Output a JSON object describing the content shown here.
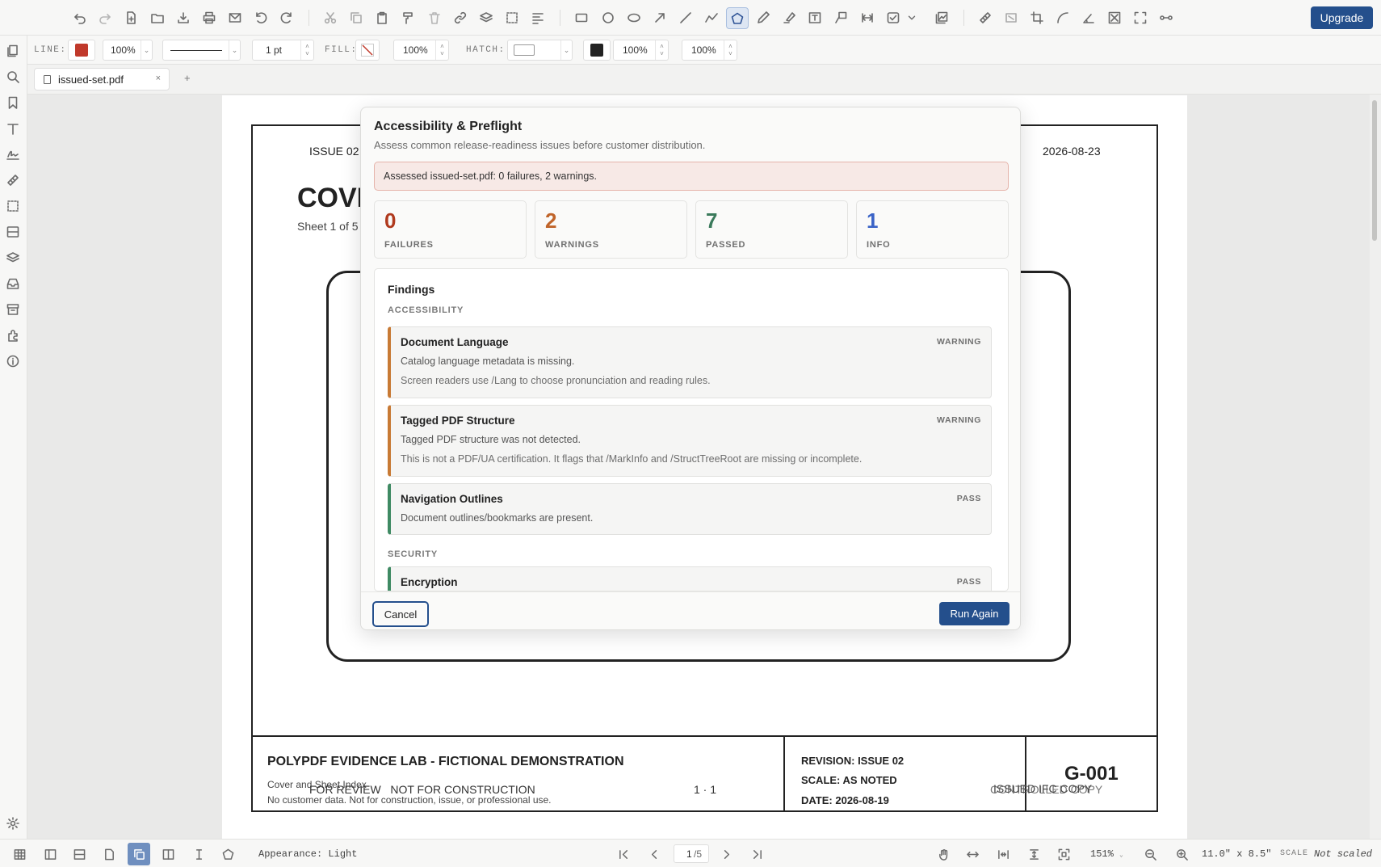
{
  "toolbar": {
    "upgrade_label": "Upgrade"
  },
  "properties": {
    "line_label": "LINE:",
    "line_color": "#c0392b",
    "line_opacity": "100%",
    "line_width": "1 pt",
    "fill_label": "FILL:",
    "fill_opacity": "100%",
    "hatch_label": "HATCH:",
    "hatch_color": "#222222",
    "opacity_a": "100%",
    "opacity_b": "100%"
  },
  "tabs": [
    {
      "label": "issued-set.pdf",
      "close": "×"
    }
  ],
  "tab_add": "+",
  "document": {
    "issue": "ISSUE 02",
    "date": "2026-08-23",
    "heading": "COVI",
    "sheet": "Sheet 1 of 5",
    "project_title": "POLYPDF EVIDENCE LAB - FICTIONAL DEMONSTRATION",
    "subtitle": "Cover and Sheet Index",
    "disclaimer": "No customer data. Not for construction, issue, or professional use.",
    "watermark_left": "FOR REVIEW   NOT FOR CONSTRUCTION",
    "watermark_mid": "1 · 1",
    "revision": "REVISION: ISSUE 02",
    "scale": "SCALE: AS NOTED",
    "date_line": "DATE: 2026-08-19",
    "sheet_number": "G-001",
    "stamp_a": "ISSUED IFC COPY",
    "stamp_b": "CONTROLLED COPY"
  },
  "dialog": {
    "title": "Accessibility & Preflight",
    "subtitle": "Assess common release-readiness issues before customer distribution.",
    "alert": "Assessed issued-set.pdf: 0 failures, 2 warnings.",
    "stats": [
      {
        "value": "0",
        "label": "FAILURES",
        "color": "#b03a1e"
      },
      {
        "value": "2",
        "label": "WARNINGS",
        "color": "#c0642a"
      },
      {
        "value": "7",
        "label": "PASSED",
        "color": "#3a7a5b"
      },
      {
        "value": "1",
        "label": "INFO",
        "color": "#3a63c7"
      }
    ],
    "findings_title": "Findings",
    "sections": [
      {
        "name": "ACCESSIBILITY"
      },
      {
        "name": "SECURITY"
      }
    ],
    "items": [
      {
        "title": "Document Language",
        "status": "WARNING",
        "message": "Catalog language metadata is missing.",
        "note": "Screen readers use /Lang to choose pronunciation and reading rules."
      },
      {
        "title": "Tagged PDF Structure",
        "status": "WARNING",
        "message": "Tagged PDF structure was not detected.",
        "note": "This is not a PDF/UA certification. It flags that /MarkInfo and /StructTreeRoot are missing or incomplete."
      },
      {
        "title": "Navigation Outlines",
        "status": "PASS",
        "message": "Document outlines/bookmarks are present."
      },
      {
        "title": "Encryption",
        "status": "PASS"
      }
    ],
    "warning_color": "#c87a35",
    "pass_color": "#3f8a63",
    "cancel_label": "Cancel",
    "run_label": "Run Again"
  },
  "statusbar": {
    "appearance": "Appearance: Light",
    "page_current": "1",
    "page_total": "/5",
    "zoom": "151%",
    "paper_size": "11.0\" x 8.5\"",
    "scale_label": "SCALE",
    "scale_value": "Not scaled"
  }
}
